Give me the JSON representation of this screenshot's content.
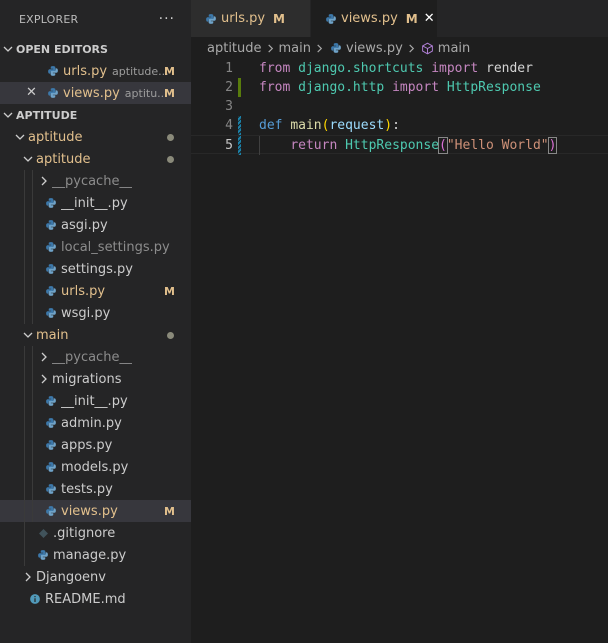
{
  "sidebar": {
    "title": "EXPLORER",
    "more": "···",
    "open_editors": {
      "heading": "OPEN EDITORS",
      "items": [
        {
          "name": "urls.py",
          "desc": "aptitude...",
          "status": "M"
        },
        {
          "name": "views.py",
          "desc": "aptitu...",
          "status": "M"
        }
      ]
    },
    "workspace": {
      "heading": "APTITUDE",
      "rows": {
        "aptitude_root": "aptitude",
        "aptitude_pkg": "aptitude",
        "pycache1": "__pycache__",
        "init1": "__init__.py",
        "asgi": "asgi.py",
        "local_settings": "local_settings.py",
        "settings": "settings.py",
        "urls": "urls.py",
        "urls_status": "M",
        "wsgi": "wsgi.py",
        "main": "main",
        "pycache2": "__pycache__",
        "migrations": "migrations",
        "init2": "__init__.py",
        "admin": "admin.py",
        "apps": "apps.py",
        "models": "models.py",
        "tests": "tests.py",
        "views": "views.py",
        "views_status": "M",
        "gitignore": ".gitignore",
        "manage": "manage.py",
        "djangoenv": "Djangoenv",
        "readme": "README.md"
      }
    }
  },
  "tabs": [
    {
      "label": "urls.py",
      "status": "M"
    },
    {
      "label": "views.py",
      "status": "M",
      "close": "✕"
    }
  ],
  "breadcrumb": [
    "aptitude",
    "main",
    "views.py",
    "main"
  ],
  "editor": {
    "lines": [
      {
        "n": "1",
        "tokens": [
          [
            "kw",
            "from"
          ],
          [
            "plain",
            " "
          ],
          [
            "mod",
            "django.shortcuts"
          ],
          [
            "plain",
            " "
          ],
          [
            "kw",
            "import"
          ],
          [
            "plain",
            " "
          ],
          [
            "plain",
            "render"
          ]
        ]
      },
      {
        "n": "2",
        "tokens": [
          [
            "kw",
            "from"
          ],
          [
            "plain",
            " "
          ],
          [
            "mod",
            "django.http"
          ],
          [
            "plain",
            " "
          ],
          [
            "kw",
            "import"
          ],
          [
            "plain",
            " "
          ],
          [
            "mod",
            "HttpResponse"
          ]
        ]
      },
      {
        "n": "3",
        "tokens": []
      },
      {
        "n": "4",
        "tokens": [
          [
            "kw2",
            "def"
          ],
          [
            "plain",
            " "
          ],
          [
            "fn",
            "main"
          ],
          [
            "paren",
            "("
          ],
          [
            "param",
            "request"
          ],
          [
            "paren",
            ")"
          ],
          [
            "plain",
            ":"
          ]
        ]
      },
      {
        "n": "5",
        "tokens": [
          [
            "plain",
            "    "
          ],
          [
            "kw",
            "return"
          ],
          [
            "plain",
            " "
          ],
          [
            "mod",
            "HttpResponse"
          ],
          [
            "paren2",
            "("
          ],
          [
            "str",
            "\"Hello World\""
          ],
          [
            "paren2",
            ")"
          ]
        ]
      }
    ]
  },
  "colors": {
    "modified": "#e2c08d",
    "git_added_gutter": "#587c0c",
    "git_modified_gutter": "#1b81a8"
  }
}
